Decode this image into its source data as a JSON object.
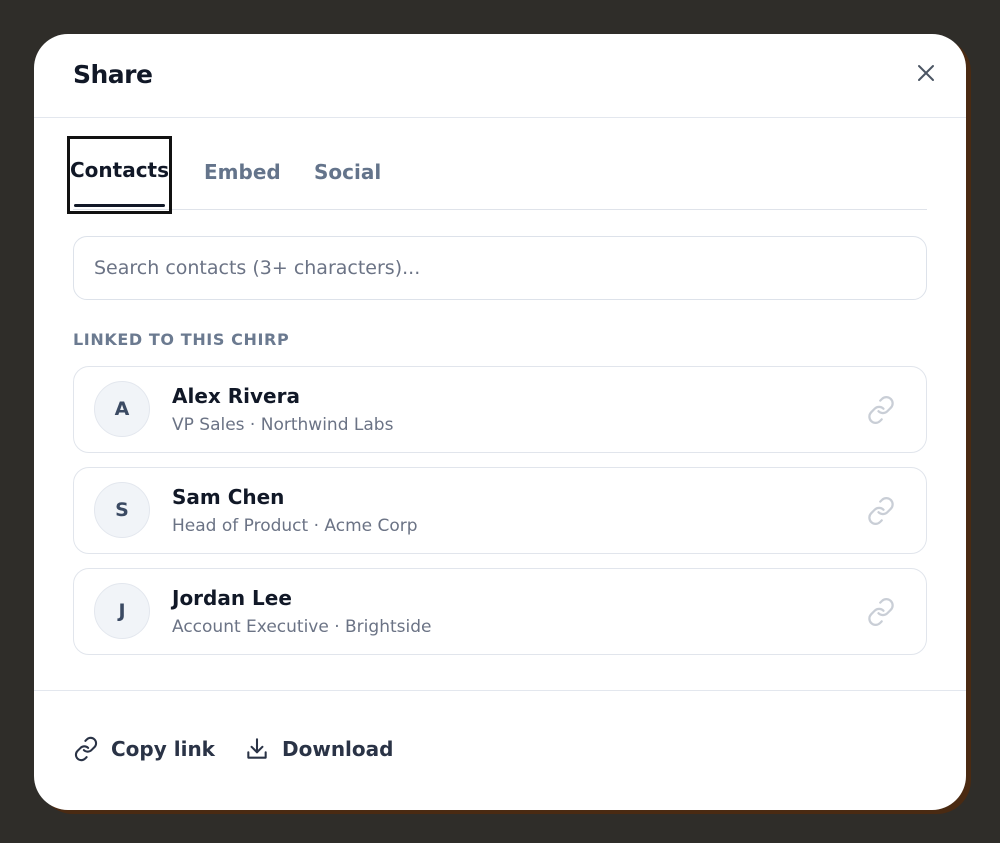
{
  "dialog": {
    "title": "Share",
    "close_icon": "close-icon"
  },
  "tabs": [
    {
      "label": "Contacts",
      "active": true
    },
    {
      "label": "Embed",
      "active": false
    },
    {
      "label": "Social",
      "active": false
    }
  ],
  "search": {
    "value": "",
    "placeholder": "Search contacts (3+ characters)..."
  },
  "section": {
    "label": "LINKED TO THIS CHIRP"
  },
  "contacts": [
    {
      "initial": "A",
      "name": "Alex Rivera",
      "subtitle": "VP Sales · Northwind Labs",
      "icon": "link-icon"
    },
    {
      "initial": "S",
      "name": "Sam Chen",
      "subtitle": "Head of Product · Acme Corp",
      "icon": "link-icon"
    },
    {
      "initial": "J",
      "name": "Jordan Lee",
      "subtitle": "Account Executive · Brightside",
      "icon": "link-icon"
    }
  ],
  "footer": {
    "copy_label": "Copy link",
    "copy_icon": "link-icon",
    "download_label": "Download",
    "download_icon": "download-icon"
  },
  "colors": {
    "backdrop": "#2f2d29",
    "text_primary": "#111827",
    "text_muted": "#6b7385",
    "border": "#e1e5ec"
  }
}
